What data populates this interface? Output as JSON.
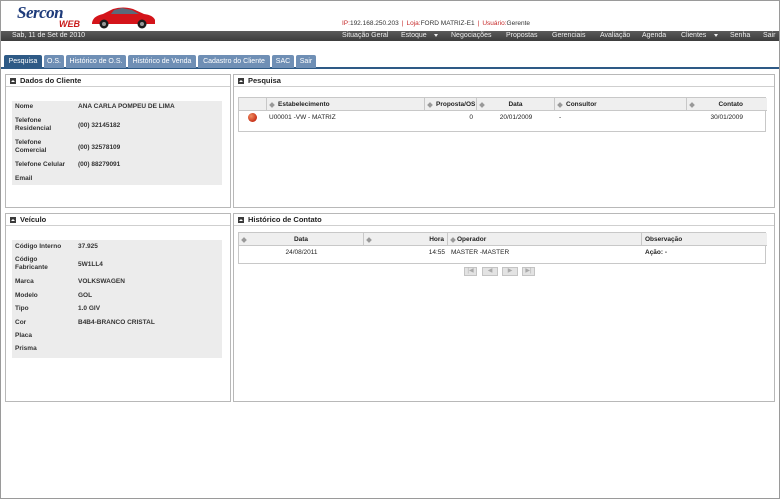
{
  "header": {
    "logo_text": "Sercon",
    "logo_sub": "WEB",
    "ip_label": "IP:",
    "ip": "192.168.250.203",
    "loja_label": "Loja:",
    "loja": "FORD MATRIZ-E1",
    "usuario_label": "Usuário:",
    "usuario": "Gerente",
    "separator": "|"
  },
  "nav": {
    "date": "Sab, 11 de Set de 2010",
    "items": [
      {
        "label": "Situação Geral"
      },
      {
        "label": "Estoque",
        "dropdown": true
      },
      {
        "label": "Negociações"
      },
      {
        "label": "Propostas"
      },
      {
        "label": "Gerenciais"
      },
      {
        "label": "Avaliação"
      },
      {
        "label": "Agenda"
      },
      {
        "label": "Clientes",
        "dropdown": true
      },
      {
        "label": "Senha"
      },
      {
        "label": "Sair"
      }
    ]
  },
  "tabs": [
    {
      "label": "Pesquisa",
      "active": true
    },
    {
      "label": "O.S."
    },
    {
      "label": "Histórico de O.S."
    },
    {
      "label": "Histórico de Venda"
    },
    {
      "label": "Cadastro do Cliente"
    },
    {
      "label": "SAC"
    },
    {
      "label": "Sair"
    }
  ],
  "cliente": {
    "title": "Dados do Cliente",
    "fields": [
      {
        "label": "Nome",
        "value": "ANA CARLA POMPEU DE LIMA"
      },
      {
        "label": "Telefone Residencial",
        "value": "(00) 32145182"
      },
      {
        "label": "Telefone Comercial",
        "value": "(00) 32578109"
      },
      {
        "label": "Telefone Celular",
        "value": "(00) 88279091"
      },
      {
        "label": "Email",
        "value": ""
      }
    ]
  },
  "pesquisa": {
    "title": "Pesquisa",
    "headers": [
      "Estabelecimento",
      "Proposta/OS",
      "Data",
      "Consultor",
      "Contato"
    ],
    "rows": [
      {
        "estabelecimento": "U00001 -VW - MATRIZ",
        "proposta": "0",
        "data": "20/01/2009",
        "consultor": "-",
        "contato": "30/01/2009"
      }
    ]
  },
  "veiculo": {
    "title": "Veículo",
    "fields": [
      {
        "label": "Código Interno",
        "value": "37.925"
      },
      {
        "label": "Código Fabricante",
        "value": "5W1LL4"
      },
      {
        "label": "Marca",
        "value": "VOLKSWAGEN"
      },
      {
        "label": "Modelo",
        "value": "GOL"
      },
      {
        "label": "Tipo",
        "value": "1.0 GIV"
      },
      {
        "label": "Cor",
        "value": "B4B4-BRANCO CRISTAL"
      },
      {
        "label": "Placa",
        "value": ""
      },
      {
        "label": "Prisma",
        "value": ""
      }
    ]
  },
  "historico": {
    "title": "Histórico de Contato",
    "headers": [
      "Data",
      "Hora",
      "Operador",
      "Observação"
    ],
    "rows": [
      {
        "data": "24/08/2011",
        "hora": "14:55",
        "operador": "MASTER -MASTER",
        "observacao": "Ação: -"
      }
    ],
    "pager": [
      "first",
      "prev",
      "next",
      "last"
    ]
  },
  "colors": {
    "tab_active": "#2e5a86",
    "tab_inactive": "#6f8fb5",
    "nav_bg": "#4a4a4a",
    "logo_red": "#c91a1a",
    "logo_blue": "#1e3b7a"
  }
}
